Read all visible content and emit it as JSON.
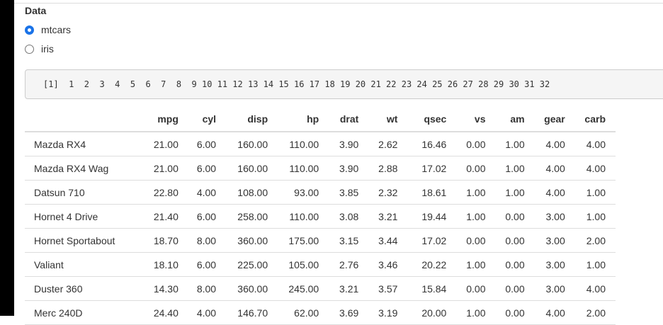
{
  "data_label": "Data",
  "radio_options": [
    "mtcars",
    "iris"
  ],
  "selected_dataset": "mtcars",
  "print_output": "[1]  1  2  3  4  5  6  7  8  9 10 11 12 13 14 15 16 17 18 19 20 21 22 23 24 25 26 27 28 29 30 31 32",
  "table": {
    "headers": [
      "",
      "mpg",
      "cyl",
      "disp",
      "hp",
      "drat",
      "wt",
      "qsec",
      "vs",
      "am",
      "gear",
      "carb"
    ],
    "rows": [
      [
        "Mazda RX4",
        "21.00",
        "6.00",
        "160.00",
        "110.00",
        "3.90",
        "2.62",
        "16.46",
        "0.00",
        "1.00",
        "4.00",
        "4.00"
      ],
      [
        "Mazda RX4 Wag",
        "21.00",
        "6.00",
        "160.00",
        "110.00",
        "3.90",
        "2.88",
        "17.02",
        "0.00",
        "1.00",
        "4.00",
        "4.00"
      ],
      [
        "Datsun 710",
        "22.80",
        "4.00",
        "108.00",
        "93.00",
        "3.85",
        "2.32",
        "18.61",
        "1.00",
        "1.00",
        "4.00",
        "1.00"
      ],
      [
        "Hornet 4 Drive",
        "21.40",
        "6.00",
        "258.00",
        "110.00",
        "3.08",
        "3.21",
        "19.44",
        "1.00",
        "0.00",
        "3.00",
        "1.00"
      ],
      [
        "Hornet Sportabout",
        "18.70",
        "8.00",
        "360.00",
        "175.00",
        "3.15",
        "3.44",
        "17.02",
        "0.00",
        "0.00",
        "3.00",
        "2.00"
      ],
      [
        "Valiant",
        "18.10",
        "6.00",
        "225.00",
        "105.00",
        "2.76",
        "3.46",
        "20.22",
        "1.00",
        "0.00",
        "3.00",
        "1.00"
      ],
      [
        "Duster 360",
        "14.30",
        "8.00",
        "360.00",
        "245.00",
        "3.21",
        "3.57",
        "15.84",
        "0.00",
        "0.00",
        "3.00",
        "4.00"
      ],
      [
        "Merc 240D",
        "24.40",
        "4.00",
        "146.70",
        "62.00",
        "3.69",
        "3.19",
        "20.00",
        "1.00",
        "0.00",
        "4.00",
        "2.00"
      ]
    ]
  }
}
